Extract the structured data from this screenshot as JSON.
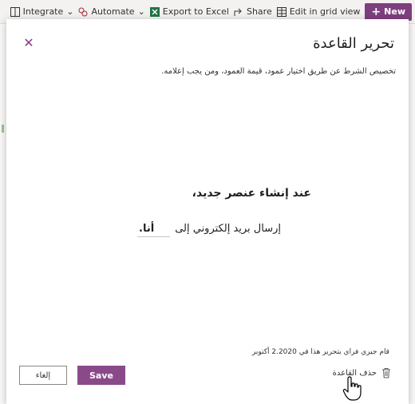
{
  "commandbar": {
    "new_label": "New",
    "edit_grid_label": "Edit in grid view",
    "share_label": "Share",
    "export_label": "Export to Excel",
    "automate_label": "Automate",
    "integrate_label": "Integrate"
  },
  "dialog": {
    "title": "تحرير القاعدة",
    "description": "تخصيص الشرط عن طريق اختيار عمود، قيمة العمود، ومن يجب إعلامه.",
    "trigger_text": "عند إنشاء عنصر جديد،",
    "action_prefix": "إرسال بريد إلكتروني إلى",
    "action_value": "أنا.",
    "meta_text": "قام جيري فراي بتحرير هذا في 2.2020 أكتوبر",
    "delete_label": "حذف القاعدة",
    "save_label": "Save",
    "cancel_label": "إلغاء"
  },
  "colors": {
    "accent": "#8a4a8a",
    "new_button": "#7e3f7e"
  },
  "icons": [
    "plus-icon",
    "grid-icon",
    "share-icon",
    "excel-icon",
    "automate-icon",
    "integrate-icon",
    "close-icon",
    "trash-icon",
    "hand-cursor-icon"
  ]
}
